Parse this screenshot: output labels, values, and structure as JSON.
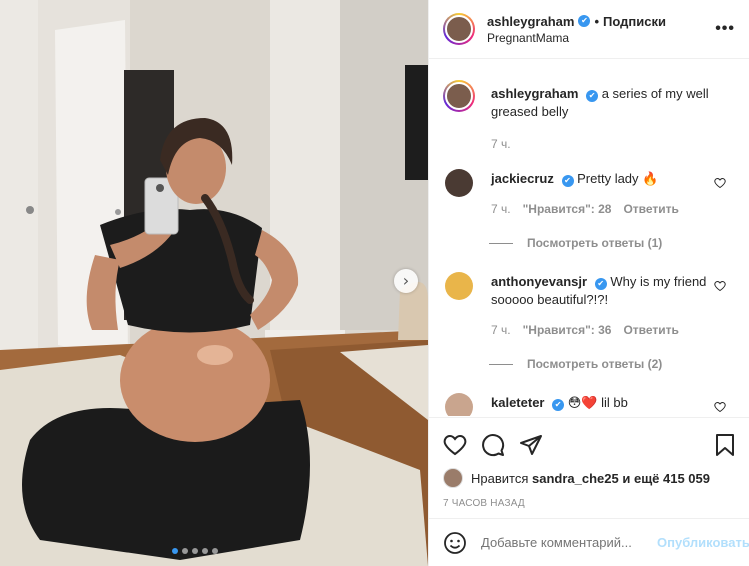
{
  "post": {
    "author": "ashleygraham",
    "follow_label": "Подписки",
    "location": "PregnantMama",
    "more_label": "•••"
  },
  "caption": {
    "user": "ashleygraham",
    "text": "a series of my well greased belly",
    "time": "7 ч."
  },
  "comments": [
    {
      "user": "jackiecruz",
      "text": "Pretty lady 🔥",
      "time": "7 ч.",
      "likes": "\"Нравится\": 28",
      "reply": "Ответить",
      "view_replies": "Посмотреть ответы (1)"
    },
    {
      "user": "anthonyevansjr",
      "text": "Why is my friend sooooo beautiful?!?!",
      "time": "7 ч.",
      "likes": "\"Нравится\": 36",
      "reply": "Ответить",
      "view_replies": "Посмотреть ответы (2)"
    },
    {
      "user": "kaleteter",
      "text": "😳❤️ lil bb"
    }
  ],
  "likes": {
    "prefix": "Нравится",
    "user": "sandra_che25",
    "suffix": "и ещё 415 059"
  },
  "timestamp": "7 ЧАСОВ НАЗАД",
  "add_comment": {
    "placeholder": "Добавьте комментарий...",
    "post_label": "Опубликовать"
  },
  "icons": {
    "verified": "✔",
    "next": "›"
  },
  "colors": {
    "accent": "#3897f0",
    "post_disabled": "#b2dffc"
  },
  "carousel": {
    "slides": 5,
    "current": 1
  }
}
